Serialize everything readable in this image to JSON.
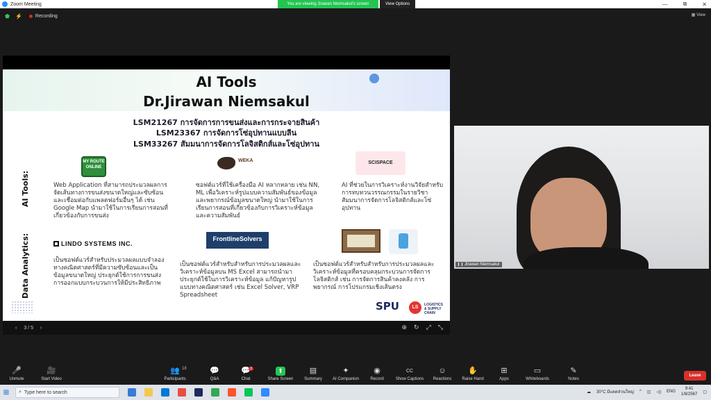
{
  "window": {
    "title": "Zoom Meeting",
    "controls": [
      "—",
      "⧉",
      "✕"
    ]
  },
  "share_banner": {
    "message": "You are viewing Jirawan Niemsakul's screen",
    "options_label": "View Options"
  },
  "meeting_top": {
    "recording_label": "Recording",
    "view_label": "View"
  },
  "slide": {
    "title1": "AI Tools",
    "title2": "Dr.Jirawan Niemsakul",
    "courses": [
      "LSM21267 การจัดการการขนส่งและการกระจายสินค้า",
      "LSM23367 การจัดการโซ่อุปทานแบบลีน",
      "LSM33267 สัมมนาการจัดการโลจิสติกส์และโซ่อุปทาน"
    ],
    "section_ai_tools": "AI Tools:",
    "section_data_analytics": "Data Analytics:",
    "logos": {
      "myroute": "MY ROUTE ONLINE",
      "weka": "WEKA",
      "scispace": "SCISPACE",
      "lindo": "LINDO SYSTEMS INC.",
      "frontline": "FrontlineSolvers",
      "spu": "SPU",
      "logistics": "LOGISTICS & SUPPLY CHAIN"
    },
    "desc_myroute": "Web Application ที่สามารถประมวลผลการจัดเส้นทางการขนส่งขนาดใหญ่และซับซ้อนและเชื่อมต่อกับแพลตฟอร์มอื่นๆ ได้ เช่น Google Map นำมาใช้ในการเรียนการสอนที่เกี่ยวข้องกับการขนส่ง",
    "desc_weka": "ซอฟต์แวร์ที่ใช้เครื่องมือ AI หลากหลาย เช่น NN, ML เพื่อวิเคราะห์รูปแบบความสัมพันธ์ของข้อมูลและพยากรณ์ข้อมูลขนาดใหญ่ นำมาใช้ในการเรียนการสอนที่เกี่ยวข้องกับการวิเคราะห์ข้อมูลและความสัมพันธ์",
    "desc_scispace": "AI ที่ช่วยในการวิเคราะห์งานวิจัยสำหรับการทบทวนวรรณกรรมในรายวิชาสัมมนาการจัดการโลจิสติกส์และโซ่อุปทาน",
    "desc_lindo": "เป็นซอฟต์แวร์สำหรับประมวลผลแบบจำลองทางคณิตศาสตร์ที่มีความซับซ้อนและเป็นข้อมูลขนาดใหญ่ ประยุกต์ใช้การการขนส่ง การออกแบบกระบวนการให้มีประสิทธิภาพ",
    "desc_frontline": "เป็นซอฟต์แวร์สำหรับสำหรับการประมวลผลและวิเคราะห์ข้อมูลบน MS Excel สามารถนำมาประยุกต์ใช้ในการวิเคราะห์ข้อมูล แก้ปัญหารูปแบบทางคณิตศาสตร์ เช่น Excel Solver, VRP Spreadsheet",
    "desc_books": "เป็นซอฟต์แวร์สำหรับสำหรับการประมวลผลและวิเคราะห์ข้อมูลที่ครอบคลุมกระบวนการจัดการโลจิสติกส์ เช่น การจัดการสินค้าคงคลัง การพยากรณ์ การโปรแกรมเชิงเส้นตรง",
    "page_indicator": "3 / 5"
  },
  "video": {
    "participant_name": "Jirawan Niemsakul"
  },
  "toolbar": {
    "items": [
      {
        "label": "Unmute",
        "icon": "🎤"
      },
      {
        "label": "Start Video",
        "icon": "🎥"
      },
      {
        "label": "Participants",
        "icon": "👥",
        "count": "18"
      },
      {
        "label": "Q&A",
        "icon": "💬"
      },
      {
        "label": "Chat",
        "icon": "💬",
        "badge": "3"
      },
      {
        "label": "Share Screen",
        "icon": "⬆"
      },
      {
        "label": "Summary",
        "icon": "▤"
      },
      {
        "label": "AI Companion",
        "icon": "✦"
      },
      {
        "label": "Record",
        "icon": "◉"
      },
      {
        "label": "Show Captions",
        "icon": "CC"
      },
      {
        "label": "Reactions",
        "icon": "☺"
      },
      {
        "label": "Raise Hand",
        "icon": "✋"
      },
      {
        "label": "Apps",
        "icon": "⊞"
      },
      {
        "label": "Whiteboards",
        "icon": "▭"
      },
      {
        "label": "Notes",
        "icon": "✎"
      }
    ],
    "leave_label": "Leave"
  },
  "taskbar": {
    "search_placeholder": "Type here to search",
    "weather": "30°C มีแดดส่วนใหญ่",
    "language": "ENG",
    "time": "9:41",
    "date": "1/8/2567"
  }
}
